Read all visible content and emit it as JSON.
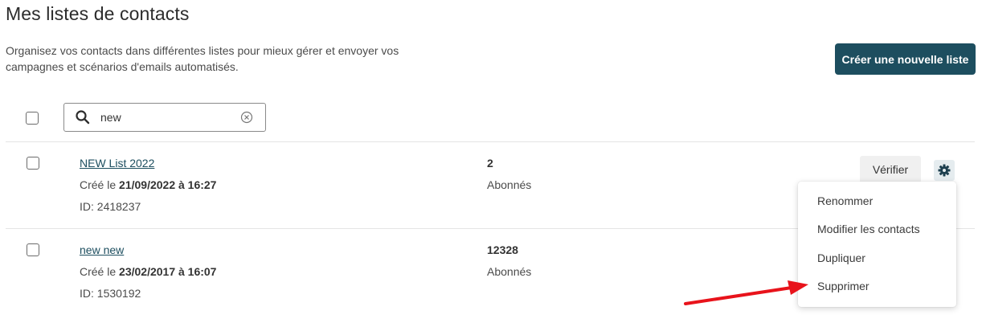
{
  "page": {
    "title": "Mes listes de contacts",
    "description": "Organisez vos contacts dans différentes listes pour mieux gérer et envoyer vos campagnes et scénarios d'emails automatisés.",
    "create_button": "Créer une nouvelle liste"
  },
  "search": {
    "value": "new",
    "icon": "search-icon",
    "clear_icon": "clear-icon"
  },
  "lists": [
    {
      "name": "NEW List 2022",
      "created_prefix": "Créé le ",
      "created_date": "21/09/2022 à 16:27",
      "id_text": "ID: 2418237",
      "count": "2",
      "count_label": "Abonnés"
    },
    {
      "name": "new new",
      "created_prefix": "Créé le ",
      "created_date": "23/02/2017 à 16:07",
      "id_text": "ID: 1530192",
      "count": "12328",
      "count_label": "Abonnés"
    }
  ],
  "row_actions": {
    "verify_label": "Vérifier",
    "settings_icon": "gear-icon"
  },
  "dropdown_menu": {
    "items": [
      "Renommer",
      "Modifier les contacts",
      "Dupliquer",
      "Supprimer"
    ]
  },
  "colors": {
    "primary": "#1d4e5f",
    "annotation_arrow": "#e8131b"
  }
}
